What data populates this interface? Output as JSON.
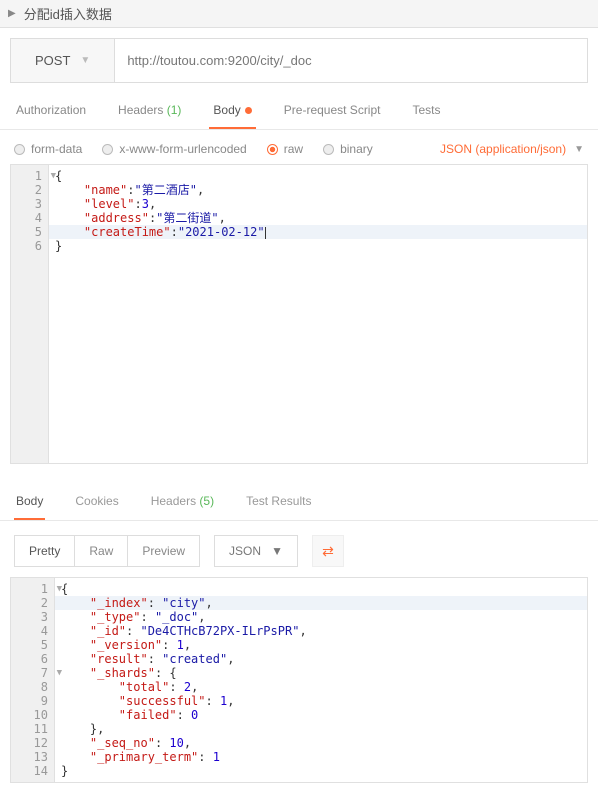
{
  "header": {
    "title": "分配id插入数据"
  },
  "request": {
    "method": "POST",
    "url": "http://toutou.com:9200/city/_doc"
  },
  "tabs": {
    "authorization": "Authorization",
    "headers": "Headers",
    "headers_count": "(1)",
    "body": "Body",
    "prerequest": "Pre-request Script",
    "tests": "Tests"
  },
  "body_options": {
    "formdata": "form-data",
    "xform": "x-www-form-urlencoded",
    "raw": "raw",
    "binary": "binary",
    "format": "JSON (application/json)"
  },
  "req_code": {
    "l1": "{",
    "l2_k": "\"name\"",
    "l2_v": "\"第二酒店\"",
    "l3_k": "\"level\"",
    "l3_v": "3",
    "l4_k": "\"address\"",
    "l4_v": "\"第二街道\"",
    "l5_k": "\"createTime\"",
    "l5_v": "\"2021-02-12\"",
    "l6": "}"
  },
  "response_tabs": {
    "body": "Body",
    "cookies": "Cookies",
    "headers": "Headers",
    "headers_count": "(5)",
    "testresults": "Test Results"
  },
  "response_toolbar": {
    "pretty": "Pretty",
    "raw": "Raw",
    "preview": "Preview",
    "json": "JSON"
  },
  "resp_code": {
    "l1": "{",
    "l2_k": "\"_index\"",
    "l2_v": "\"city\"",
    "l3_k": "\"_type\"",
    "l3_v": "\"_doc\"",
    "l4_k": "\"_id\"",
    "l4_v": "\"De4CTHcB72PX-ILrPsPR\"",
    "l5_k": "\"_version\"",
    "l5_v": "1",
    "l6_k": "\"result\"",
    "l6_v": "\"created\"",
    "l7_k": "\"_shards\"",
    "l7_v": "{",
    "l8_k": "\"total\"",
    "l8_v": "2",
    "l9_k": "\"successful\"",
    "l9_v": "1",
    "l10_k": "\"failed\"",
    "l10_v": "0",
    "l11": "},",
    "l12_k": "\"_seq_no\"",
    "l12_v": "10",
    "l13_k": "\"_primary_term\"",
    "l13_v": "1",
    "l14": "}"
  }
}
